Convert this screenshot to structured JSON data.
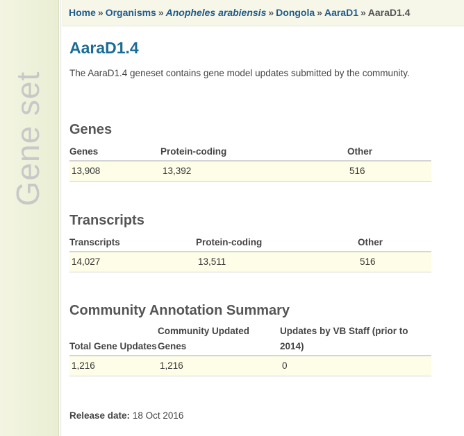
{
  "sidebar": {
    "label": "Gene set"
  },
  "breadcrumb": {
    "home": "Home",
    "organisms": "Organisms",
    "species": "Anopheles arabiensis",
    "strain": "Dongola",
    "assembly": "AaraD1",
    "current": "AaraD1.4",
    "separator": "»"
  },
  "page": {
    "title": "AaraD1.4",
    "intro": "The AaraD1.4 geneset contains gene model updates submitted by the community."
  },
  "genes": {
    "heading": "Genes",
    "columns": [
      "Genes",
      "Protein-coding",
      "Other"
    ],
    "row": [
      "13,908",
      "13,392",
      "516"
    ]
  },
  "transcripts": {
    "heading": "Transcripts",
    "columns": [
      "Transcripts",
      "Protein-coding",
      "Other"
    ],
    "row": [
      "14,027",
      "13,511",
      "516"
    ]
  },
  "community": {
    "heading": "Community Annotation Summary",
    "columns": [
      "Total Gene Updates",
      "Community Updated Genes",
      "Updates by VB Staff (prior to 2014)"
    ],
    "row": [
      "1,216",
      "1,216",
      "0"
    ]
  },
  "release": {
    "label": "Release date:",
    "value": "18 Oct 2016"
  }
}
